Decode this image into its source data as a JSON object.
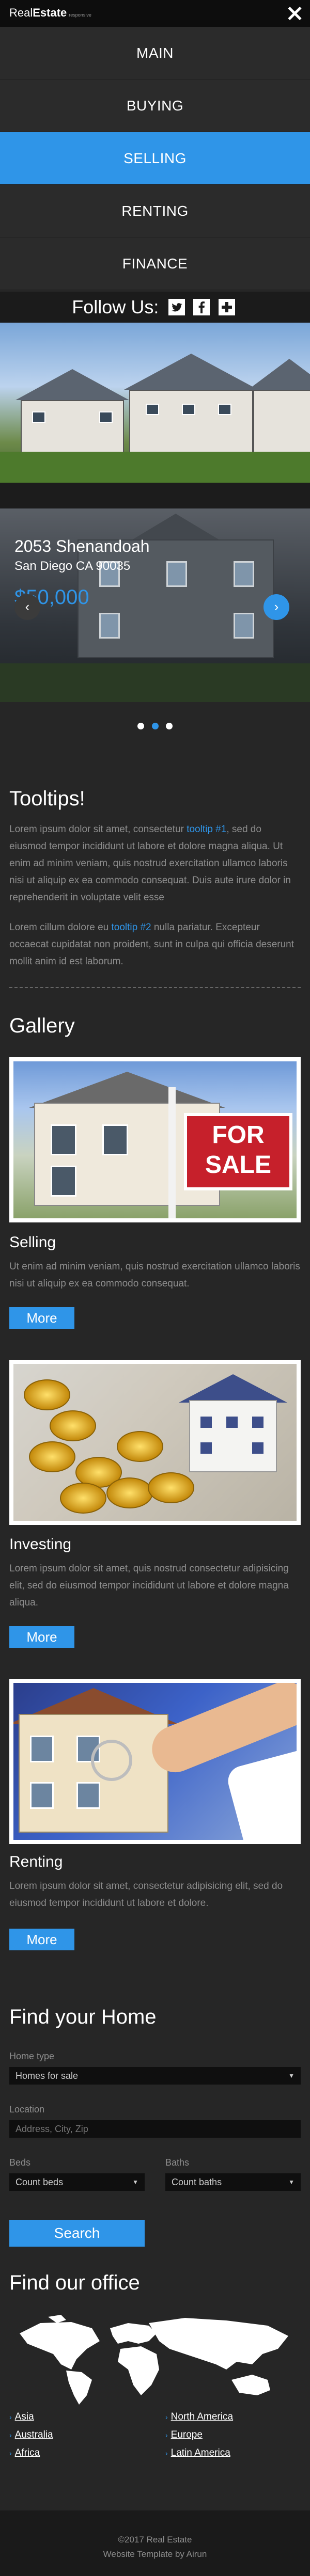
{
  "header": {
    "logo_part1": "Real",
    "logo_part2": "Estate",
    "logo_tag": "responsive"
  },
  "nav": {
    "items": [
      {
        "label": "MAIN"
      },
      {
        "label": "BUYING"
      },
      {
        "label": "SELLING"
      },
      {
        "label": "RENTING"
      },
      {
        "label": "FINANCE"
      }
    ],
    "active": "SELLING"
  },
  "follow": {
    "label": "Follow Us:",
    "icons": [
      "twitter-icon",
      "facebook-icon",
      "plus-icon"
    ]
  },
  "slider": {
    "title": "2053 Shenandoah",
    "subtitle": "San Diego CA 90035",
    "price": "$50,000",
    "active_slide_index": 1,
    "slide_count": 3
  },
  "tooltips": {
    "heading": "Tooltips!",
    "para1_before": "Lorem ipsum dolor sit amet, consectetur ",
    "para1_link": "tooltip #1",
    "para1_after": ", sed do eiusmod tempor incididunt ut labore et dolore magna aliqua. Ut enim ad minim veniam, quis nostrud exercitation ullamco laboris nisi ut aliquip ex ea commodo consequat. Duis aute irure dolor in reprehenderit in voluptate velit esse",
    "para2_before": "Lorem cillum dolore eu ",
    "para2_link": "tooltip #2",
    "para2_after": " nulla pariatur. Excepteur occaecat cupidatat non proident, sunt in culpa qui officia deserunt mollit anim id est laborum."
  },
  "gallery": {
    "heading": "Gallery",
    "items": [
      {
        "title": "Selling",
        "text": "Ut enim ad minim veniam, quis nostrud exercitation ullamco laboris nisi ut aliquip ex ea commodo consequat.",
        "button": "More",
        "sign_line1": "FOR",
        "sign_line2": "SALE"
      },
      {
        "title": "Investing",
        "text": "Lorem ipsum dolor sit amet, quis nostrud consectetur adipisicing elit, sed do eiusmod tempor incididunt ut labore et dolore magna aliqua.",
        "button": "More"
      },
      {
        "title": "Renting",
        "text": "Lorem ipsum dolor sit amet, consectetur adipisicing elit, sed do eiusmod tempor incididunt ut labore et dolore.",
        "button": "More"
      }
    ]
  },
  "find_home": {
    "heading": "Find your Home",
    "type_label": "Home type",
    "type_value": "Homes for sale",
    "location_label": "Location",
    "location_placeholder": "Address, City, Zip",
    "beds_label": "Beds",
    "beds_value": "Count beds",
    "baths_label": "Baths",
    "baths_value": "Count baths",
    "search_button": "Search"
  },
  "office": {
    "heading": "Find our office",
    "left_links": [
      "Asia",
      "Australia",
      "Africa"
    ],
    "right_links": [
      "North America",
      "Europe",
      "Latin America"
    ]
  },
  "footer": {
    "copyright": "©2017 Real Estate",
    "credit": "Website Template by Airun"
  },
  "colors": {
    "accent": "#2f95e8",
    "background": "#262626",
    "nav_bg": "#2b2b2b",
    "sign_red": "#c6202b"
  }
}
